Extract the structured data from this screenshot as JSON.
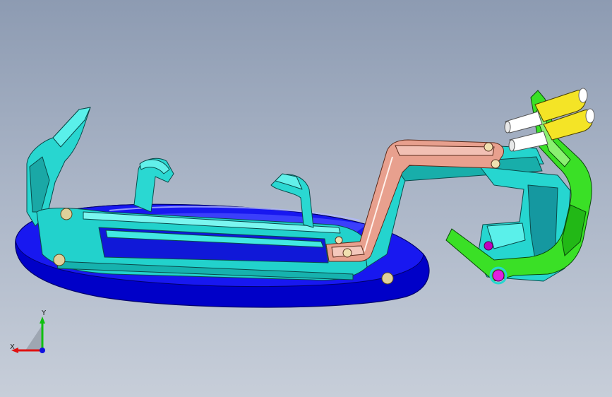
{
  "viewport": {
    "background_top": "#8d9bb2",
    "background_bottom": "#c7ced9"
  },
  "model": {
    "base_color": "#1010e0",
    "frame_color": "#26e0d8",
    "bracket_color": "#e8a090",
    "clamp_color": "#38e020",
    "cylinder_color": "#f0e020",
    "pin_color": "#ffffff",
    "hinge_color": "#c000c0",
    "bolt_color": "#d8c890"
  },
  "triad": {
    "x_label": "X",
    "y_label": "Y",
    "x_color": "#e01010",
    "y_color": "#10c010",
    "z_color": "#1010e0"
  }
}
